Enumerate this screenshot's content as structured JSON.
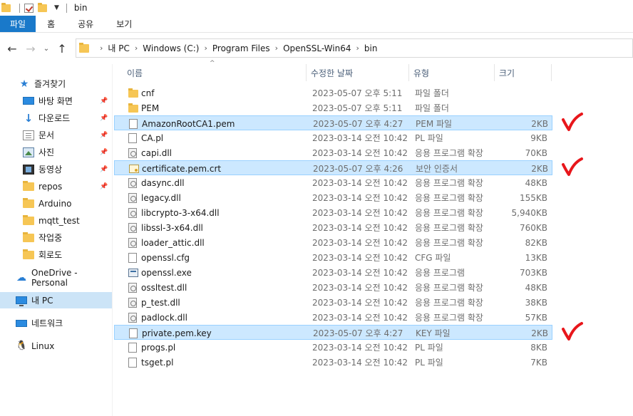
{
  "window": {
    "title": "bin"
  },
  "ribbon": {
    "tabs": [
      "파일",
      "홈",
      "공유",
      "보기"
    ]
  },
  "address": {
    "crumbs": [
      "내 PC",
      "Windows (C:)",
      "Program Files",
      "OpenSSL-Win64",
      "bin"
    ]
  },
  "nav": {
    "quick_access": "즐겨찾기",
    "items": [
      {
        "label": "바탕 화면",
        "icon": "desktop-icon",
        "pinned": true
      },
      {
        "label": "다운로드",
        "icon": "download-icon",
        "pinned": true
      },
      {
        "label": "문서",
        "icon": "document-icon",
        "pinned": true
      },
      {
        "label": "사진",
        "icon": "pictures-icon",
        "pinned": true
      },
      {
        "label": "동영상",
        "icon": "video-icon",
        "pinned": true
      },
      {
        "label": "repos",
        "icon": "folder-icon",
        "pinned": true
      },
      {
        "label": "Arduino",
        "icon": "folder-icon",
        "pinned": false
      },
      {
        "label": "mqtt_test",
        "icon": "folder-icon",
        "pinned": false
      },
      {
        "label": "작업중",
        "icon": "folder-icon",
        "pinned": false
      },
      {
        "label": "회로도",
        "icon": "folder-icon",
        "pinned": false
      }
    ],
    "onedrive": "OneDrive - Personal",
    "this_pc": "내 PC",
    "network": "네트워크",
    "linux": "Linux"
  },
  "columns": {
    "name": "이름",
    "date": "수정한 날짜",
    "type": "유형",
    "size": "크기"
  },
  "files": [
    {
      "name": "cnf",
      "date": "2023-05-07 오후 5:11",
      "type": "파일 폴더",
      "size": "",
      "icon": "folder-icon",
      "selected": false
    },
    {
      "name": "PEM",
      "date": "2023-05-07 오후 5:11",
      "type": "파일 폴더",
      "size": "",
      "icon": "folder-icon",
      "selected": false
    },
    {
      "name": "AmazonRootCA1.pem",
      "date": "2023-05-07 오후 4:27",
      "type": "PEM 파일",
      "size": "2KB",
      "icon": "file-icon",
      "selected": true
    },
    {
      "name": "CA.pl",
      "date": "2023-03-14 오전 10:42",
      "type": "PL 파일",
      "size": "9KB",
      "icon": "file-icon",
      "selected": false
    },
    {
      "name": "capi.dll",
      "date": "2023-03-14 오전 10:42",
      "type": "응용 프로그램 확장",
      "size": "70KB",
      "icon": "dll-icon",
      "selected": false
    },
    {
      "name": "certificate.pem.crt",
      "date": "2023-05-07 오후 4:26",
      "type": "보안 인증서",
      "size": "2KB",
      "icon": "certificate-icon",
      "selected": true
    },
    {
      "name": "dasync.dll",
      "date": "2023-03-14 오전 10:42",
      "type": "응용 프로그램 확장",
      "size": "48KB",
      "icon": "dll-icon",
      "selected": false
    },
    {
      "name": "legacy.dll",
      "date": "2023-03-14 오전 10:42",
      "type": "응용 프로그램 확장",
      "size": "155KB",
      "icon": "dll-icon",
      "selected": false
    },
    {
      "name": "libcrypto-3-x64.dll",
      "date": "2023-03-14 오전 10:42",
      "type": "응용 프로그램 확장",
      "size": "5,940KB",
      "icon": "dll-icon",
      "selected": false
    },
    {
      "name": "libssl-3-x64.dll",
      "date": "2023-03-14 오전 10:42",
      "type": "응용 프로그램 확장",
      "size": "760KB",
      "icon": "dll-icon",
      "selected": false
    },
    {
      "name": "loader_attic.dll",
      "date": "2023-03-14 오전 10:42",
      "type": "응용 프로그램 확장",
      "size": "82KB",
      "icon": "dll-icon",
      "selected": false
    },
    {
      "name": "openssl.cfg",
      "date": "2023-03-14 오전 10:42",
      "type": "CFG 파일",
      "size": "13KB",
      "icon": "file-icon",
      "selected": false
    },
    {
      "name": "openssl.exe",
      "date": "2023-03-14 오전 10:42",
      "type": "응용 프로그램",
      "size": "703KB",
      "icon": "exe-icon",
      "selected": false
    },
    {
      "name": "ossltest.dll",
      "date": "2023-03-14 오전 10:42",
      "type": "응용 프로그램 확장",
      "size": "48KB",
      "icon": "dll-icon",
      "selected": false
    },
    {
      "name": "p_test.dll",
      "date": "2023-03-14 오전 10:42",
      "type": "응용 프로그램 확장",
      "size": "38KB",
      "icon": "dll-icon",
      "selected": false
    },
    {
      "name": "padlock.dll",
      "date": "2023-03-14 오전 10:42",
      "type": "응용 프로그램 확장",
      "size": "57KB",
      "icon": "dll-icon",
      "selected": false
    },
    {
      "name": "private.pem.key",
      "date": "2023-05-07 오후 4:27",
      "type": "KEY 파일",
      "size": "2KB",
      "icon": "file-icon",
      "selected": true
    },
    {
      "name": "progs.pl",
      "date": "2023-03-14 오전 10:42",
      "type": "PL 파일",
      "size": "8KB",
      "icon": "file-icon",
      "selected": false
    },
    {
      "name": "tsget.pl",
      "date": "2023-03-14 오전 10:42",
      "type": "PL 파일",
      "size": "7KB",
      "icon": "file-icon",
      "selected": false
    }
  ],
  "annotations": {
    "checkmark_color": "#e8161b",
    "checked_files": [
      "AmazonRootCA1.pem",
      "certificate.pem.crt",
      "private.pem.key"
    ]
  },
  "colors": {
    "file_tab": "#1979ca",
    "selection": "#cce8ff",
    "selection_border": "#99d1ff",
    "nav_selected": "#cce4f7"
  }
}
